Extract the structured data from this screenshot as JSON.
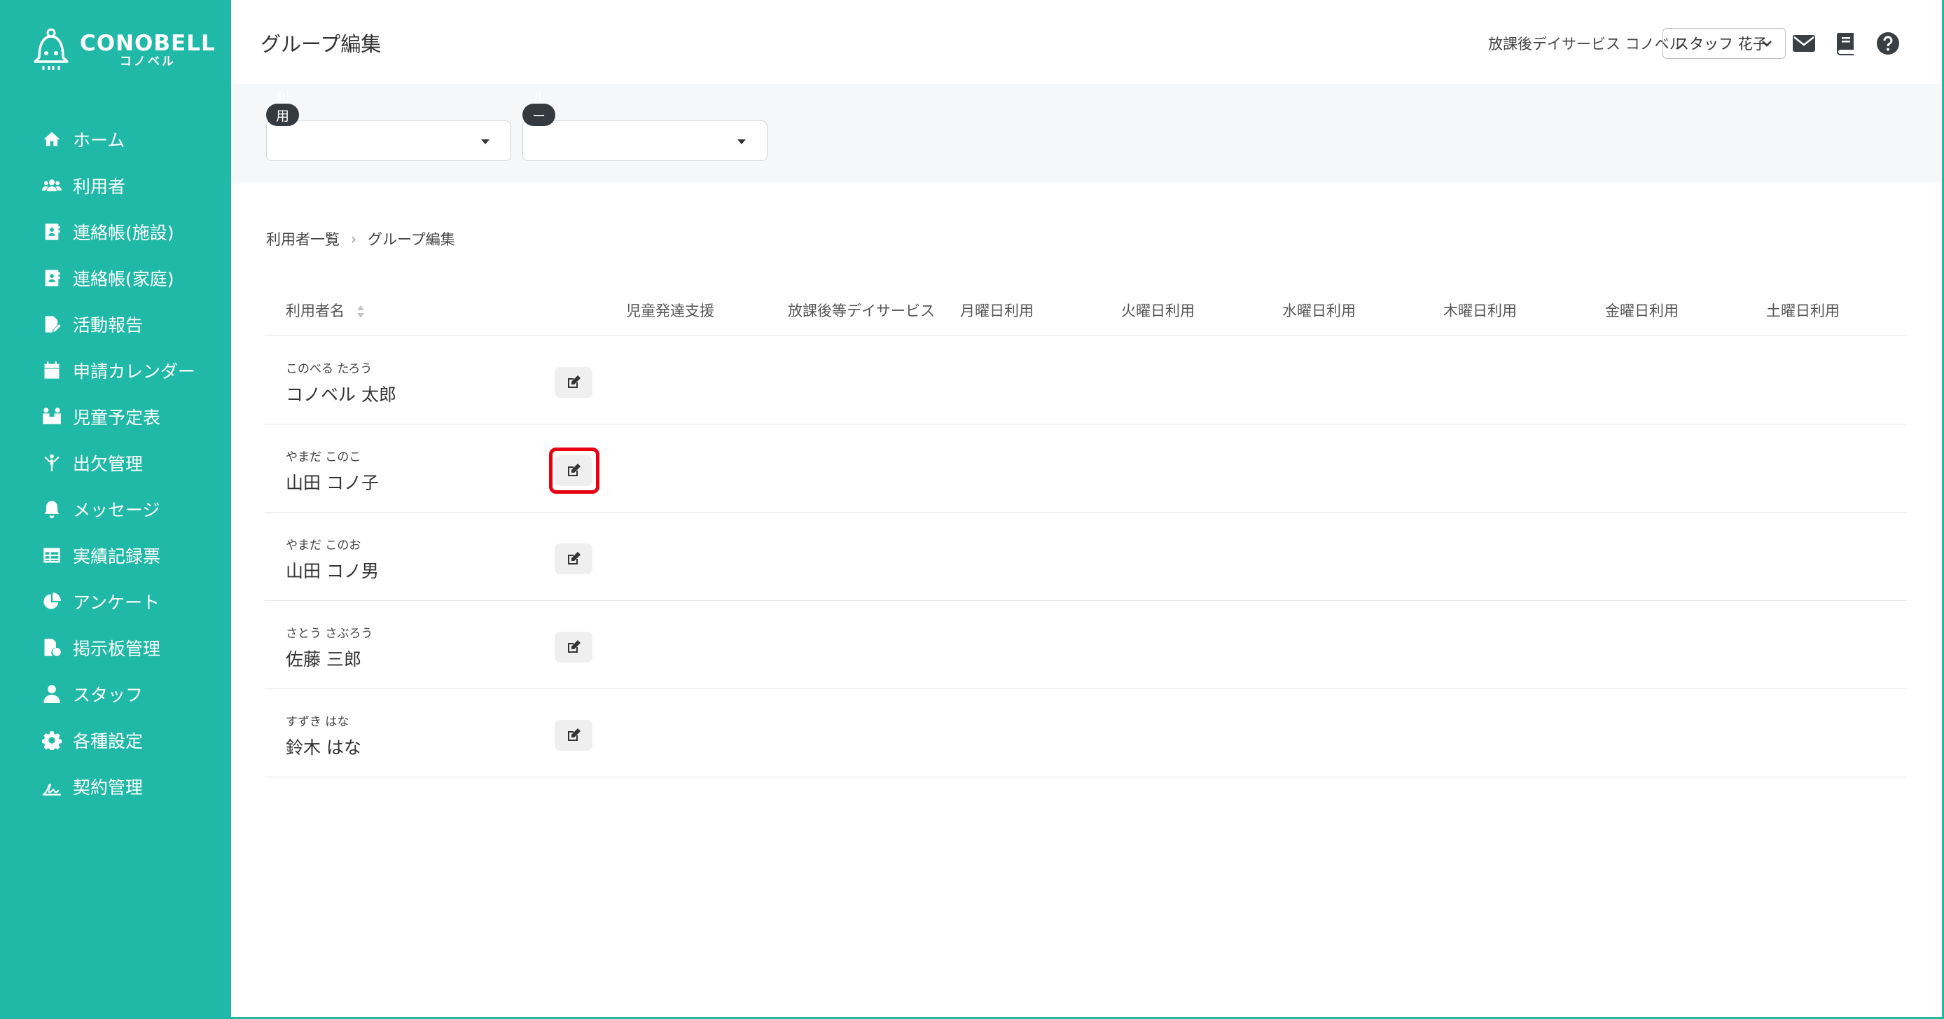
{
  "brand": {
    "name": "CONOBELL",
    "sub": "コノベル",
    "color": "#20b8a6"
  },
  "sidebar": {
    "items": [
      {
        "label": "ホーム",
        "icon": "home-icon"
      },
      {
        "label": "利用者",
        "icon": "users-icon"
      },
      {
        "label": "連絡帳(施設)",
        "icon": "contact-book-icon"
      },
      {
        "label": "連絡帳(家庭)",
        "icon": "contact-book-icon"
      },
      {
        "label": "活動報告",
        "icon": "report-icon"
      },
      {
        "label": "申請カレンダー",
        "icon": "calendar-icon"
      },
      {
        "label": "児童予定表",
        "icon": "schedule-icon"
      },
      {
        "label": "出欠管理",
        "icon": "attendance-icon"
      },
      {
        "label": "メッセージ",
        "icon": "bell-icon"
      },
      {
        "label": "実績記録票",
        "icon": "table-icon"
      },
      {
        "label": "アンケート",
        "icon": "pie-chart-icon"
      },
      {
        "label": "掲示板管理",
        "icon": "board-icon"
      },
      {
        "label": "スタッフ",
        "icon": "staff-icon"
      },
      {
        "label": "各種設定",
        "icon": "gear-icon"
      },
      {
        "label": "契約管理",
        "icon": "contract-icon"
      }
    ]
  },
  "header": {
    "title": "グループ編集",
    "facility": "放課後デイサービス コノベル",
    "staff": "スタッフ 花子"
  },
  "filters": {
    "user_label": "利用者",
    "group_label": "グループ名"
  },
  "breadcrumb": {
    "parent": "利用者一覧",
    "current": "グループ編集"
  },
  "table": {
    "columns": {
      "name": "利用者名",
      "c1": "児童発達支援",
      "c2": "放課後等デイサービス",
      "c3": "月曜日利用",
      "c4": "火曜日利用",
      "c5": "水曜日利用",
      "c6": "木曜日利用",
      "c7": "金曜日利用",
      "c8": "土曜日利用"
    },
    "rows": [
      {
        "kana": "このべる たろう",
        "name": "コノベル 太郎"
      },
      {
        "kana": "やまだ このこ",
        "name": "山田 コノ子"
      },
      {
        "kana": "やまだ このお",
        "name": "山田 コノ男"
      },
      {
        "kana": "さとう さぶろう",
        "name": "佐藤 三郎"
      },
      {
        "kana": "すずき はな",
        "name": "鈴木 はな"
      }
    ]
  }
}
